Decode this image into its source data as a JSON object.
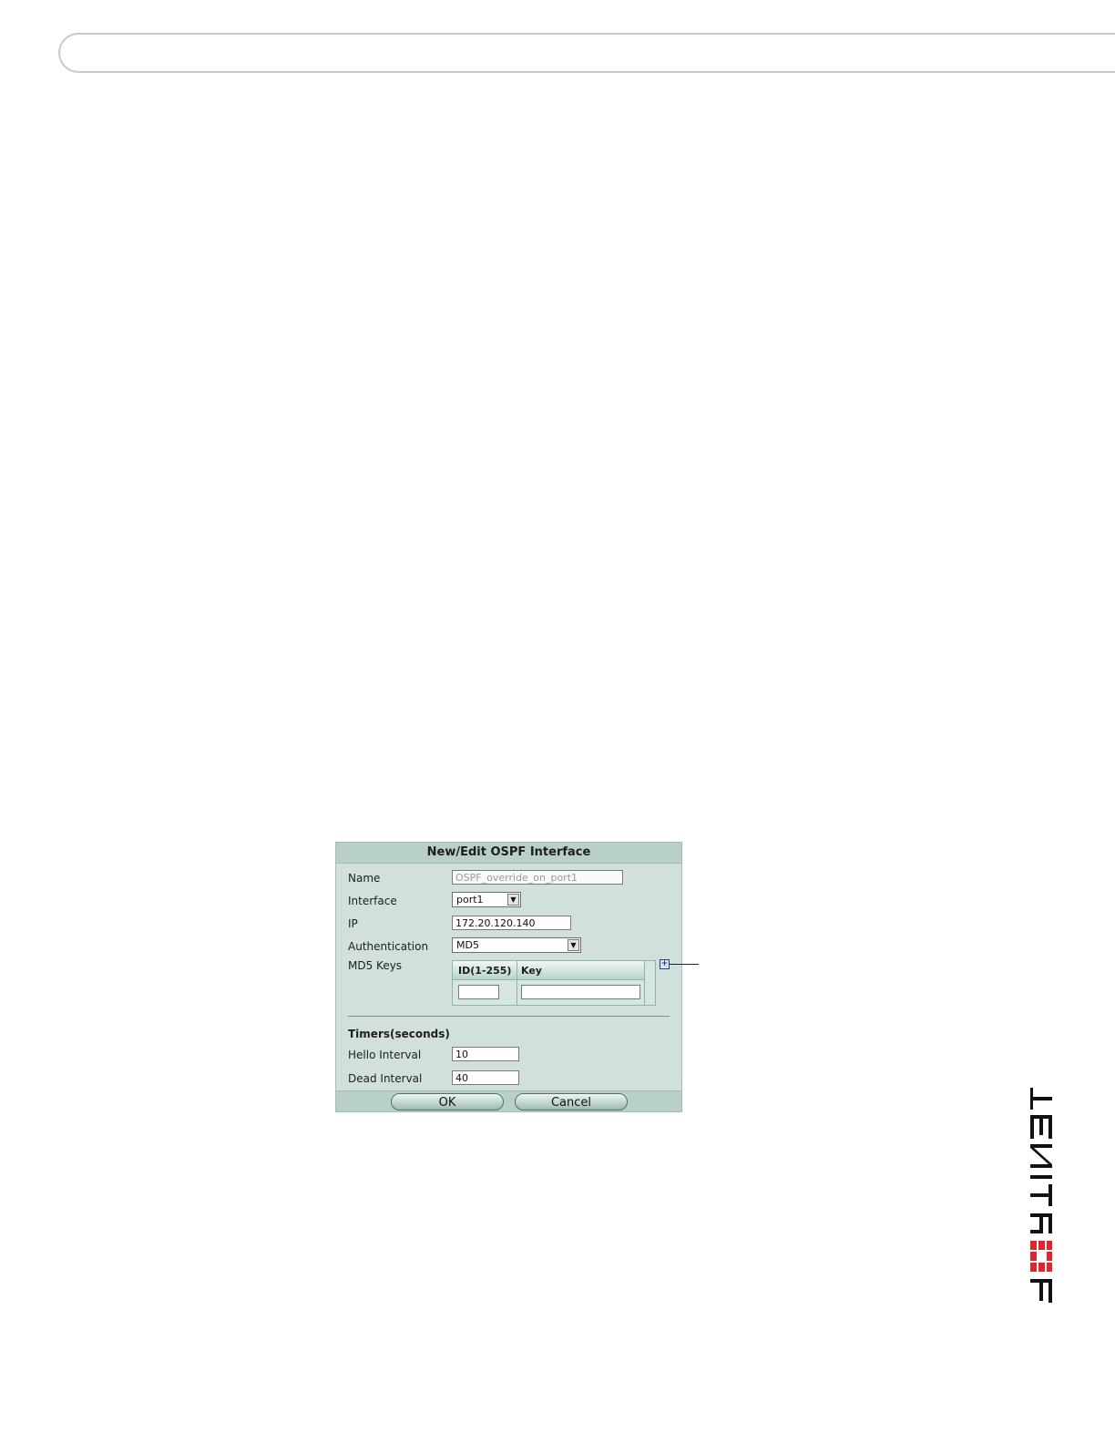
{
  "dialog": {
    "title": "New/Edit OSPF Interface",
    "name_label": "Name",
    "name_value": "OSPF_override_on_port1",
    "interface_label": "Interface",
    "interface_value": "port1",
    "ip_label": "IP",
    "ip_value": "172.20.120.140",
    "auth_label": "Authentication",
    "auth_value": "MD5",
    "md5_label": "MD5 Keys",
    "md5_col_id": "ID(1-255)",
    "md5_col_key": "Key",
    "md5_id_value": "",
    "md5_key_value": "",
    "timers_heading": "Timers(seconds)",
    "hello_label": "Hello Interval",
    "hello_value": "10",
    "dead_label": "Dead Interval",
    "dead_value": "40",
    "ok_label": "OK",
    "cancel_label": "Cancel",
    "add_icon": "+"
  },
  "branding": {
    "logo_text": "FORTINET",
    "logo_color": "#111111",
    "logo_accent": "#e3242b"
  }
}
